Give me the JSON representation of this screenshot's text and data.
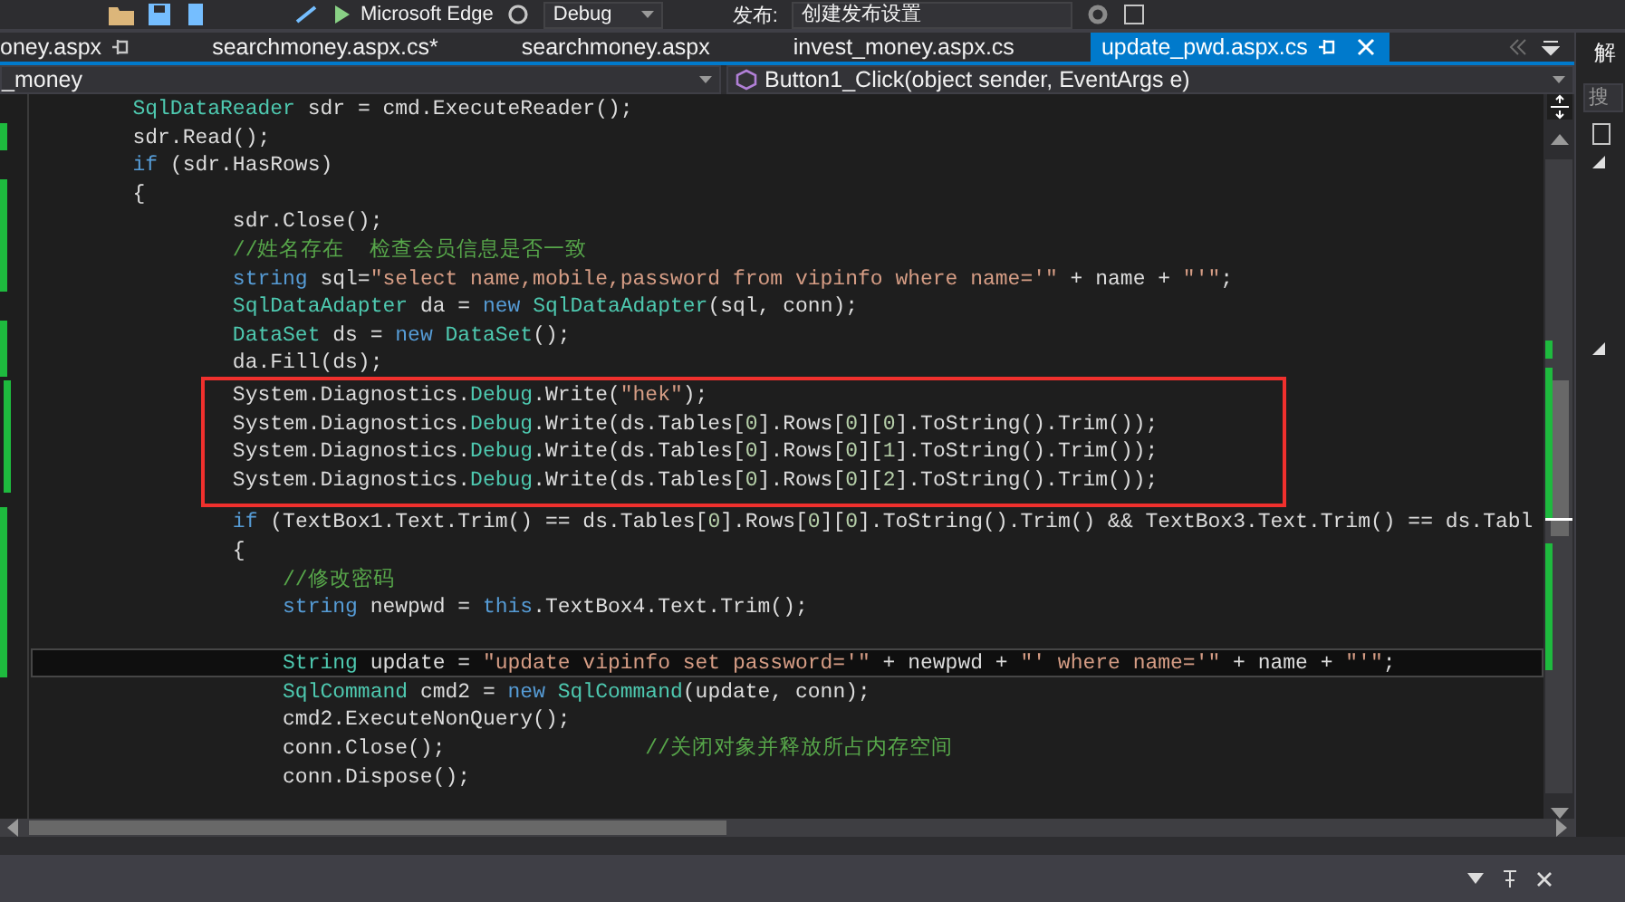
{
  "toolbar": {
    "run_target": "Microsoft Edge",
    "configuration": "Debug",
    "publish_label": "发布:",
    "publish_profile": "创建发布设置"
  },
  "tabs": [
    {
      "label": "oney.aspx",
      "selected": false,
      "pinned": true
    },
    {
      "label": "searchmoney.aspx.cs*",
      "selected": false,
      "pinned": false
    },
    {
      "label": "searchmoney.aspx",
      "selected": false,
      "pinned": false
    },
    {
      "label": "invest_money.aspx.cs",
      "selected": false,
      "pinned": false
    },
    {
      "label": "update_pwd.aspx.cs",
      "selected": true,
      "pinned": true
    }
  ],
  "nav": {
    "class_dropdown": "_money",
    "member_dropdown": "Button1_Click(object sender, EventArgs e)"
  },
  "code": {
    "lines": [
      {
        "changed": false,
        "boxed": false,
        "current": false,
        "tokens": [
          {
            "kind": "type",
            "text": "        SqlDataReader"
          },
          {
            "kind": "plain",
            "text": " sdr = cmd.ExecuteReader();"
          }
        ]
      },
      {
        "changed": true,
        "boxed": false,
        "current": false,
        "tokens": [
          {
            "kind": "plain",
            "text": "        sdr.Read();"
          }
        ]
      },
      {
        "changed": false,
        "boxed": false,
        "current": false,
        "tokens": [
          {
            "kind": "kw",
            "text": "        if"
          },
          {
            "kind": "plain",
            "text": " (sdr.HasRows)"
          }
        ]
      },
      {
        "changed": true,
        "boxed": false,
        "current": false,
        "tokens": [
          {
            "kind": "plain",
            "text": "        {"
          }
        ]
      },
      {
        "changed": true,
        "boxed": false,
        "current": false,
        "tokens": [
          {
            "kind": "plain",
            "text": "                sdr.Close();"
          }
        ]
      },
      {
        "changed": true,
        "boxed": false,
        "current": false,
        "tokens": [
          {
            "kind": "cmt",
            "text": "                //姓名存在  检查会员信息是否一致"
          }
        ]
      },
      {
        "changed": true,
        "boxed": false,
        "current": false,
        "tokens": [
          {
            "kind": "kw",
            "text": "                string"
          },
          {
            "kind": "plain",
            "text": " sql="
          },
          {
            "kind": "str",
            "text": "\"select name,mobile,password from vipinfo where name='\""
          },
          {
            "kind": "plain",
            "text": " + name + "
          },
          {
            "kind": "str",
            "text": "\"'\""
          },
          {
            "kind": "plain",
            "text": ";"
          }
        ]
      },
      {
        "changed": false,
        "boxed": false,
        "current": false,
        "tokens": [
          {
            "kind": "type",
            "text": "                SqlDataAdapter"
          },
          {
            "kind": "plain",
            "text": " da = "
          },
          {
            "kind": "kw",
            "text": "new "
          },
          {
            "kind": "type",
            "text": "SqlDataAdapter"
          },
          {
            "kind": "plain",
            "text": "(sql, conn);"
          }
        ]
      },
      {
        "changed": true,
        "boxed": false,
        "current": false,
        "tokens": [
          {
            "kind": "type",
            "text": "                DataSet"
          },
          {
            "kind": "plain",
            "text": " ds = "
          },
          {
            "kind": "kw",
            "text": "new "
          },
          {
            "kind": "type",
            "text": "DataSet"
          },
          {
            "kind": "plain",
            "text": "();"
          }
        ]
      },
      {
        "changed": true,
        "boxed": false,
        "current": false,
        "tokens": [
          {
            "kind": "plain",
            "text": "                da.Fill(ds);"
          }
        ]
      },
      {
        "changed": true,
        "boxed": true,
        "current": false,
        "tokens": [
          {
            "kind": "plain",
            "text": "                System.Diagnostics."
          },
          {
            "kind": "type",
            "text": "Debug"
          },
          {
            "kind": "plain",
            "text": ".Write("
          },
          {
            "kind": "str",
            "text": "\"hek\""
          },
          {
            "kind": "plain",
            "text": ");"
          }
        ]
      },
      {
        "changed": true,
        "boxed": true,
        "current": false,
        "tokens": [
          {
            "kind": "plain",
            "text": "                System.Diagnostics."
          },
          {
            "kind": "type",
            "text": "Debug"
          },
          {
            "kind": "plain",
            "text": ".Write(ds.Tables["
          },
          {
            "kind": "num",
            "text": "0"
          },
          {
            "kind": "plain",
            "text": "].Rows["
          },
          {
            "kind": "num",
            "text": "0"
          },
          {
            "kind": "plain",
            "text": "]["
          },
          {
            "kind": "num",
            "text": "0"
          },
          {
            "kind": "plain",
            "text": "].ToString().Trim());"
          }
        ]
      },
      {
        "changed": true,
        "boxed": true,
        "current": false,
        "tokens": [
          {
            "kind": "plain",
            "text": "                System.Diagnostics."
          },
          {
            "kind": "type",
            "text": "Debug"
          },
          {
            "kind": "plain",
            "text": ".Write(ds.Tables["
          },
          {
            "kind": "num",
            "text": "0"
          },
          {
            "kind": "plain",
            "text": "].Rows["
          },
          {
            "kind": "num",
            "text": "0"
          },
          {
            "kind": "plain",
            "text": "]["
          },
          {
            "kind": "num",
            "text": "1"
          },
          {
            "kind": "plain",
            "text": "].ToString().Trim());"
          }
        ]
      },
      {
        "changed": true,
        "boxed": true,
        "current": false,
        "tokens": [
          {
            "kind": "plain",
            "text": "                System.Diagnostics."
          },
          {
            "kind": "type",
            "text": "Debug"
          },
          {
            "kind": "plain",
            "text": ".Write(ds.Tables["
          },
          {
            "kind": "num",
            "text": "0"
          },
          {
            "kind": "plain",
            "text": "].Rows["
          },
          {
            "kind": "num",
            "text": "0"
          },
          {
            "kind": "plain",
            "text": "]["
          },
          {
            "kind": "num",
            "text": "2"
          },
          {
            "kind": "plain",
            "text": "].ToString().Trim());"
          }
        ]
      },
      {
        "changed": true,
        "boxed": false,
        "current": false,
        "tokens": [
          {
            "kind": "kw",
            "text": "                if"
          },
          {
            "kind": "plain",
            "text": " (TextBox1.Text.Trim() == ds.Tables["
          },
          {
            "kind": "num",
            "text": "0"
          },
          {
            "kind": "plain",
            "text": "].Rows["
          },
          {
            "kind": "num",
            "text": "0"
          },
          {
            "kind": "plain",
            "text": "]["
          },
          {
            "kind": "num",
            "text": "0"
          },
          {
            "kind": "plain",
            "text": "].ToString().Trim() && TextBox3.Text.Trim() == ds.Tabl"
          }
        ]
      },
      {
        "changed": true,
        "boxed": false,
        "current": false,
        "tokens": [
          {
            "kind": "plain",
            "text": "                {"
          }
        ]
      },
      {
        "changed": true,
        "boxed": false,
        "current": false,
        "tokens": [
          {
            "kind": "cmt",
            "text": "                    //修改密码"
          }
        ]
      },
      {
        "changed": true,
        "boxed": false,
        "current": false,
        "tokens": [
          {
            "kind": "kw",
            "text": "                    string"
          },
          {
            "kind": "plain",
            "text": " newpwd = "
          },
          {
            "kind": "kw",
            "text": "this"
          },
          {
            "kind": "plain",
            "text": ".TextBox4.Text.Trim();"
          }
        ]
      },
      {
        "changed": true,
        "boxed": false,
        "current": false
      },
      {
        "changed": true,
        "boxed": false,
        "current": true,
        "tokens": [
          {
            "kind": "type",
            "text": "                    String"
          },
          {
            "kind": "plain",
            "text": " update = "
          },
          {
            "kind": "str",
            "text": "\"update vipinfo set password='\""
          },
          {
            "kind": "plain",
            "text": " + newpwd + "
          },
          {
            "kind": "str",
            "text": "\"' where name='\""
          },
          {
            "kind": "plain",
            "text": " + name + "
          },
          {
            "kind": "str",
            "text": "\"'\""
          },
          {
            "kind": "plain",
            "text": ";"
          }
        ]
      },
      {
        "changed": false,
        "boxed": false,
        "current": false,
        "tokens": [
          {
            "kind": "type",
            "text": "                    SqlCommand"
          },
          {
            "kind": "plain",
            "text": " cmd2 = "
          },
          {
            "kind": "kw",
            "text": "new "
          },
          {
            "kind": "type",
            "text": "SqlCommand"
          },
          {
            "kind": "plain",
            "text": "(update, conn);"
          }
        ]
      },
      {
        "changed": false,
        "boxed": false,
        "current": false,
        "tokens": [
          {
            "kind": "plain",
            "text": "                    cmd2.ExecuteNonQuery();"
          }
        ]
      },
      {
        "changed": false,
        "boxed": false,
        "current": false,
        "tokens": [
          {
            "kind": "plain",
            "text": "                    conn.Close();                "
          },
          {
            "kind": "cmt",
            "text": "//关闭对象并释放所占内存空间"
          }
        ]
      },
      {
        "changed": false,
        "boxed": false,
        "current": false,
        "tokens": [
          {
            "kind": "plain",
            "text": "                    conn.Dispose();"
          }
        ]
      }
    ]
  },
  "side_panel": {
    "title": "解",
    "search": {
      "placeholder": "搜"
    }
  }
}
